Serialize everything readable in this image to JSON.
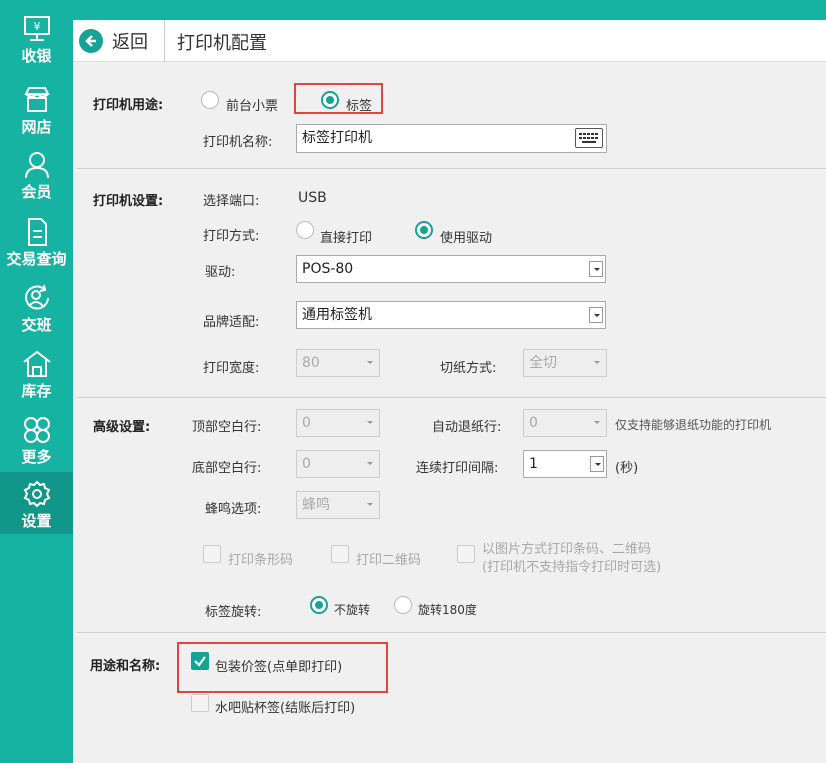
{
  "sidebar": {
    "items": [
      {
        "label": "收银",
        "icon": "cash-register-icon"
      },
      {
        "label": "网店",
        "icon": "store-icon"
      },
      {
        "label": "会员",
        "icon": "member-icon"
      },
      {
        "label": "交易查询",
        "icon": "document-icon"
      },
      {
        "label": "交班",
        "icon": "shift-handover-icon"
      },
      {
        "label": "库存",
        "icon": "warehouse-icon"
      },
      {
        "label": "更多",
        "icon": "more-grid-icon"
      },
      {
        "label": "设置",
        "icon": "gear-icon"
      }
    ],
    "active_index": 7,
    "color": "#16b3a2"
  },
  "header": {
    "title": "打印机配置",
    "back_label": "返回"
  },
  "usage": {
    "section_label": "打印机用途:",
    "options": [
      "前台小票",
      "标签"
    ],
    "selected": "标签",
    "name_label": "打印机名称:",
    "name_value": "标签打印机"
  },
  "printer_settings": {
    "section_label": "打印机设置:",
    "port_label": "选择端口:",
    "port_value": "USB",
    "method_label": "打印方式:",
    "method_options": [
      "直接打印",
      "使用驱动"
    ],
    "method_selected": "使用驱动",
    "driver_label": "驱动:",
    "driver_value": "POS-80",
    "brand_label": "品牌适配:",
    "brand_value": "通用标签机",
    "width_label": "打印宽度:",
    "width_value": "80",
    "cut_label": "切纸方式:",
    "cut_value": "全切"
  },
  "advanced": {
    "section_label": "高级设置:",
    "top_blank_label": "顶部空白行:",
    "top_blank_value": "0",
    "auto_retreat_label": "自动退纸行:",
    "auto_retreat_value": "0",
    "auto_retreat_note": "仅支持能够退纸功能的打印机",
    "bottom_blank_label": "底部空白行:",
    "bottom_blank_value": "0",
    "interval_label": "连续打印间隔:",
    "interval_value": "1",
    "interval_unit": "(秒)",
    "beep_label": "蜂鸣选项:",
    "beep_value": "蜂鸣",
    "cb_barcode": "打印条形码",
    "cb_qrcode": "打印二维码",
    "cb_image_line1": "以图片方式打印条码、二维码",
    "cb_image_line2": "(打印机不支持指令打印时可选)",
    "rotate_label": "标签旋转:",
    "rotate_options": [
      "不旋转",
      "旋转180度"
    ],
    "rotate_selected": "不旋转"
  },
  "usage_names": {
    "section_label": "用途和名称:",
    "items": [
      {
        "label": "包装价签(点单即打印)",
        "checked": true
      },
      {
        "label": "水吧贴杯签(结账后打印)",
        "checked": false
      }
    ]
  },
  "colors": {
    "accent": "#16a396",
    "highlight": "#e0463c"
  }
}
